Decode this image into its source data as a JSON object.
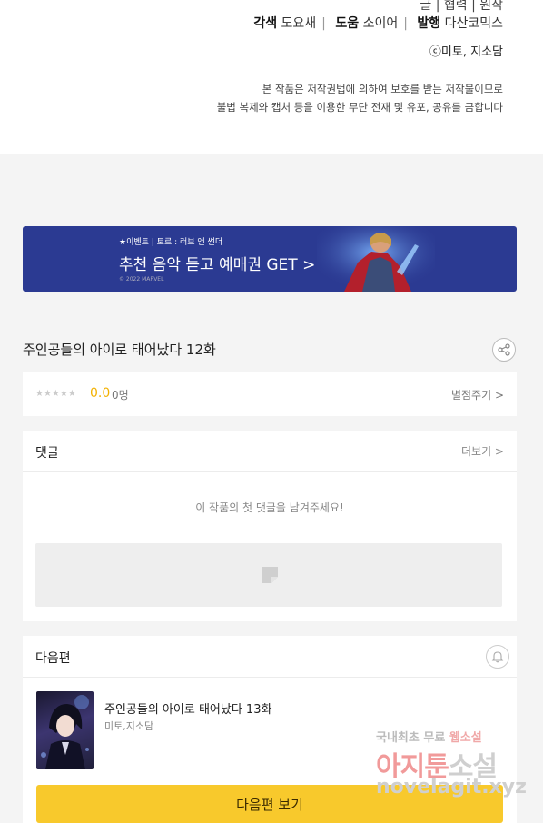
{
  "credits": {
    "line0": "글 | 협력 | 원작",
    "adapt_label": "각색",
    "adapt_name": "도요새",
    "assist_label": "도움",
    "assist_name": "소이어",
    "publish_label": "발행",
    "publish_name": "다산코믹스",
    "copyright": "ⓒ미토, 지소담",
    "legal_1": "본 작품은 저작권법에 의하여 보호를 받는 저작물이므로",
    "legal_2": "불법 복제와 캡처 등을 이용한 무단 전재 및 유포, 공유를 금합니다"
  },
  "banner": {
    "event": "★이벤트 | 토르 : 러브 앤 썬더",
    "cta": "추천 음악 듣고 예매권 GET >",
    "marvel": "© 2022 MARVEL"
  },
  "episode": {
    "title": "주인공들의 아이로 태어났다 12화"
  },
  "rating": {
    "stars": "★★★★★",
    "score": "0.0",
    "count": "0명",
    "rate_link": "별점주기 >"
  },
  "comments": {
    "header": "댓글",
    "more": "더보기 >",
    "empty": "이 작품의 첫 댓글을 남겨주세요!"
  },
  "next": {
    "header": "다음편",
    "title": "주인공들의 아이로 태어났다 13화",
    "author": "미토,지소담",
    "button": "다음편 보기"
  },
  "watermark": {
    "line1a": "국내최초 무료",
    "line1b": "웹소설",
    "line2a": "아지툰",
    "line2b": "소설",
    "line3": "novelagit.xyz"
  },
  "colors": {
    "accent": "#f8c92c",
    "score": "#f3b100",
    "banner": "#2b3a92"
  }
}
